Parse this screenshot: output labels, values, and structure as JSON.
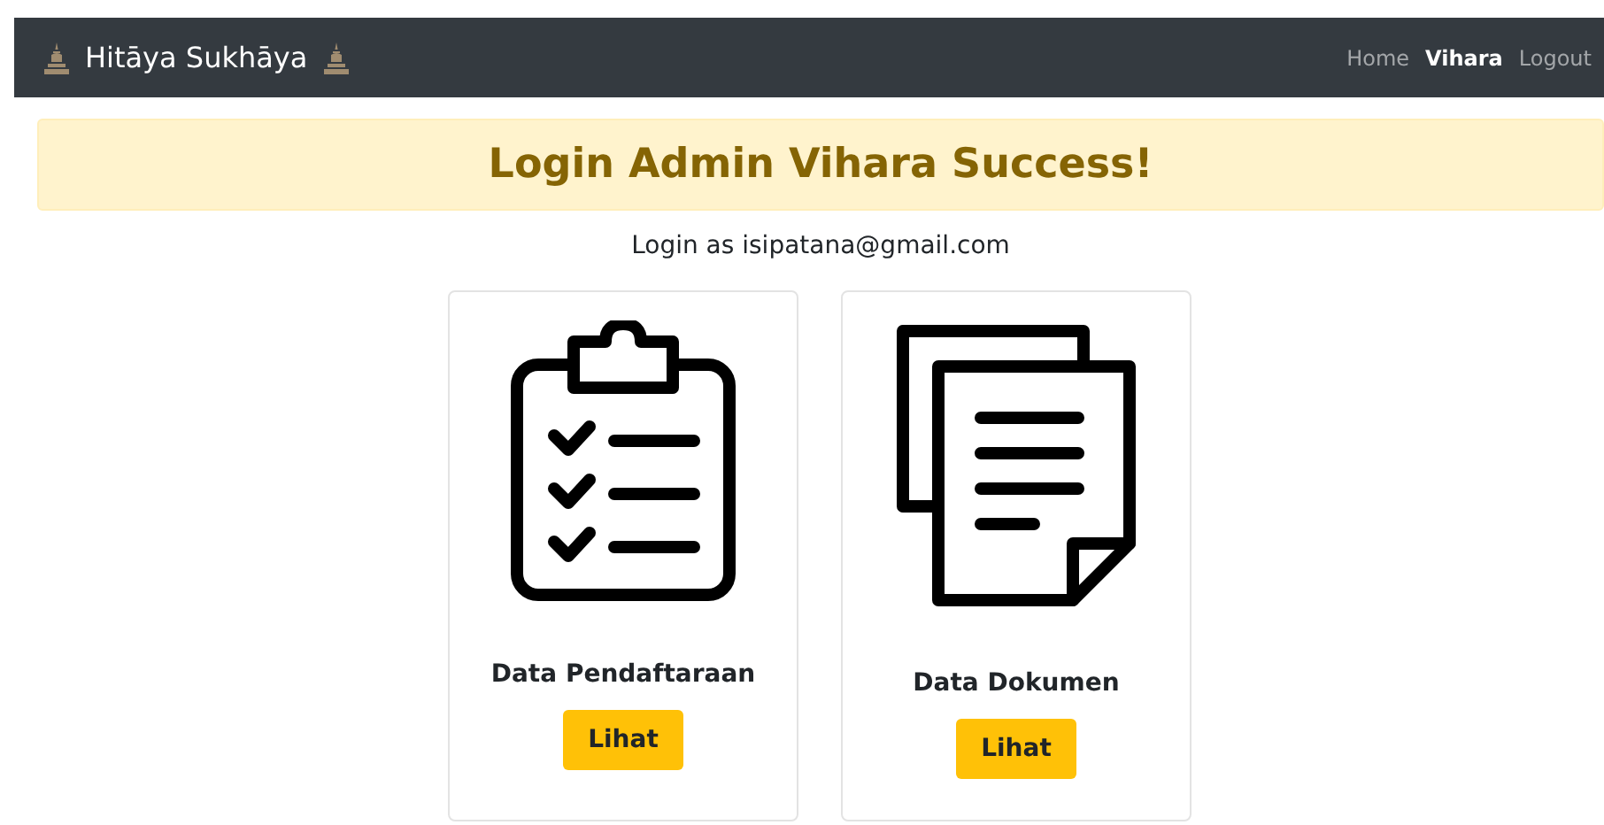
{
  "navbar": {
    "brand": "Hitāya Sukhāya",
    "links": [
      {
        "label": "Home",
        "selected": false
      },
      {
        "label": "Vihara",
        "selected": true
      },
      {
        "label": "Logout",
        "selected": false
      }
    ]
  },
  "alert": {
    "title": "Login Admin Vihara Success!"
  },
  "login_info": "Login as isipatana@gmail.com",
  "cards": [
    {
      "kind": "checklist",
      "title": "Data Pendaftaraan",
      "button": "Lihat"
    },
    {
      "kind": "documents",
      "title": "Data Dokumen",
      "button": "Lihat"
    }
  ]
}
